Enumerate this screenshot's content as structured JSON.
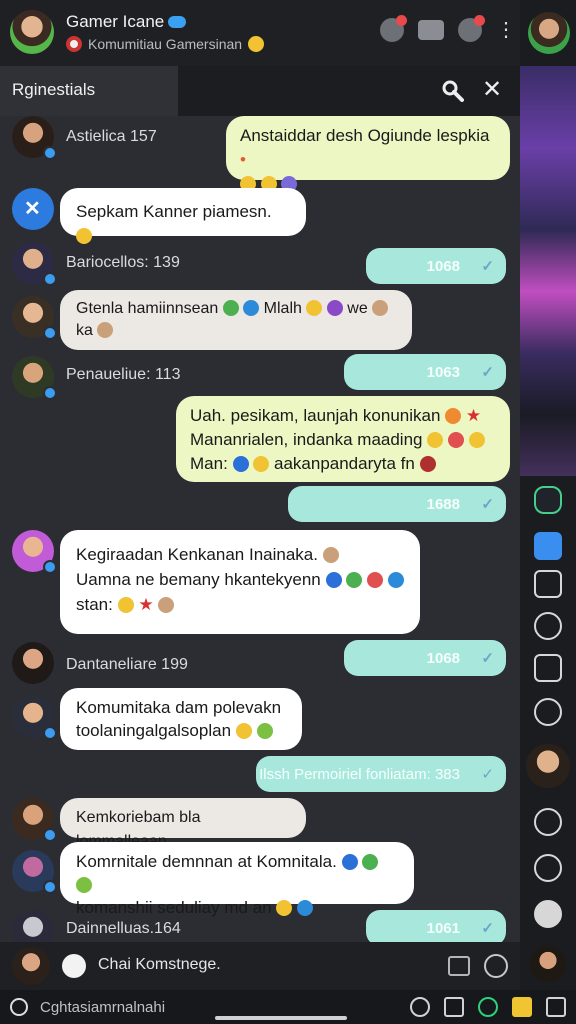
{
  "header": {
    "title": "Gamer Icane",
    "subtitle": "Komumitiau Gamersinan",
    "icons": [
      "notification-icon",
      "video-icon",
      "game-icon",
      "more-options-icon"
    ]
  },
  "searchbar": {
    "label": "Rginestials"
  },
  "messages": [
    {
      "type": "in-name",
      "name": "Astielica 157"
    },
    {
      "type": "out",
      "text_line1": "Anstaiddar desh Ogiunde lespkia",
      "emojis": 3
    },
    {
      "type": "in",
      "text": "Sepkam Kanner piamesn."
    },
    {
      "type": "in-name",
      "name": "Bariocellos: 139",
      "count": "1068"
    },
    {
      "type": "in",
      "text_line1": "Gtenla hamiinnsean",
      "text_line1b": "Mlalh",
      "text_line1c": "we",
      "text_line2": "ka"
    },
    {
      "type": "in-name",
      "name": "Penaueliue: 113",
      "count": "1063"
    },
    {
      "type": "out",
      "text_line1": "Uah. pesikam, launjah konunikan",
      "text_line2": "Mananrialen, indanka maading",
      "text_line3": "Man:",
      "text_line3b": "aakanpandaryta fn"
    },
    {
      "type": "count-only",
      "count": "1688"
    },
    {
      "type": "in",
      "text_line1": "Kegiraadan Kenkanan Inainaka.",
      "text_line2": "Uamna ne bemany hkantekyenn",
      "text_line3": "stan:"
    },
    {
      "type": "in-name",
      "name": "Dantaneliare 199",
      "count": "1068"
    },
    {
      "type": "in",
      "text_line1": "Komumitaka dam polevakn",
      "text_line2": "toolaningalgalsoplan"
    },
    {
      "type": "count-only",
      "count": "Ilssh Permoiriel fonliatam: 383"
    },
    {
      "type": "in",
      "text": "Kemkoriebam bla lommalleaan"
    },
    {
      "type": "in",
      "text_line1": "Komrnitale demnnan at Komnitala.",
      "text_line2": "komanshii seduliay md an"
    },
    {
      "type": "in-name",
      "name": "Dainnelluas.164",
      "count": "1061"
    }
  ],
  "input": {
    "placeholder": "Chai Komstnege."
  },
  "bottombar": {
    "label": "Cghtasiamrnalnahi"
  }
}
